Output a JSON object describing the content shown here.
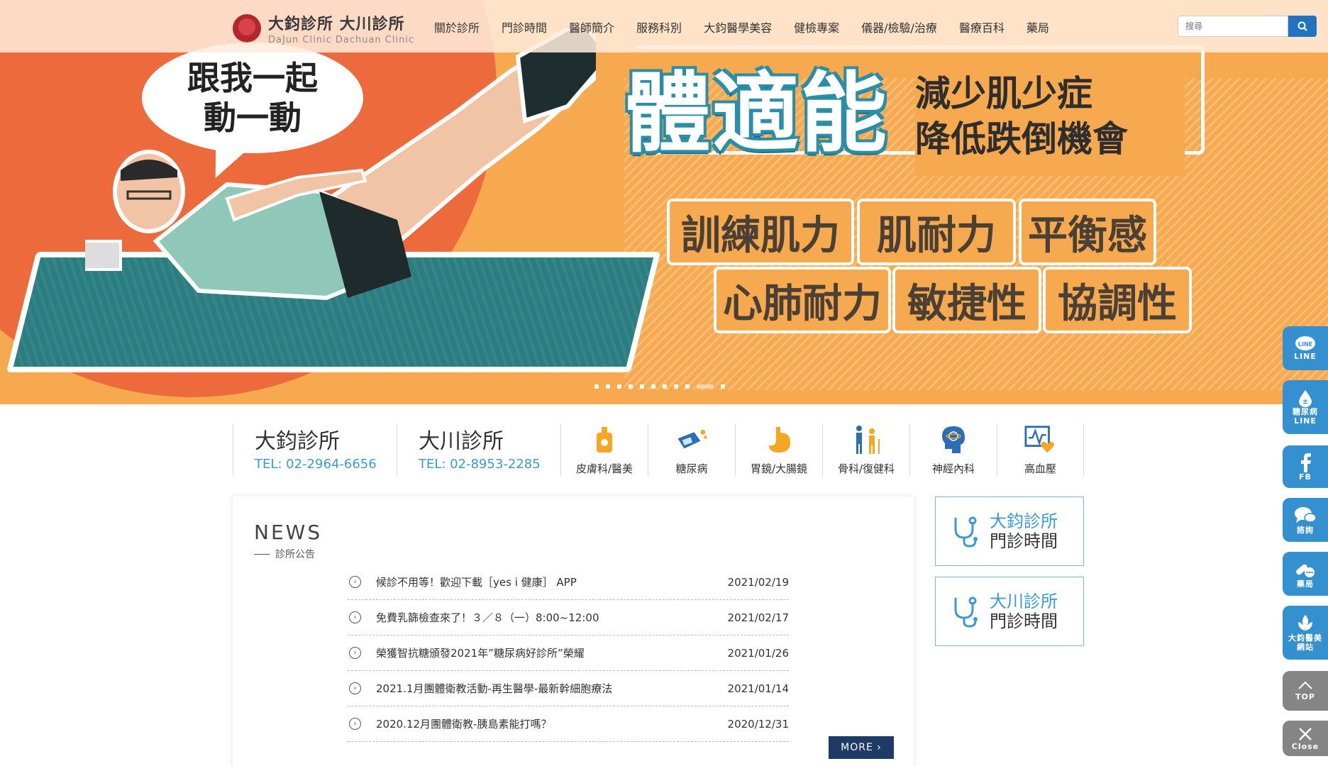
{
  "header": {
    "logo_zh": "大鈞診所 大川診所",
    "logo_en": "DaJun Clinic  Dachuan Clinic",
    "nav": [
      "關於診所",
      "門診時間",
      "醫師簡介",
      "服務科別",
      "大鈞醫學美容",
      "健檢專案",
      "儀器/檢驗/治療",
      "醫療百科",
      "藥局"
    ],
    "search_placeholder": "搜尋"
  },
  "hero": {
    "bubble": "跟我一起動一動",
    "title": "體適能",
    "sub1": "減少肌少症",
    "sub2": "降低跌倒機會",
    "skills": [
      "訓練肌力",
      "肌耐力",
      "平衡感",
      "心肺耐力",
      "敏捷性",
      "協調性"
    ],
    "slide_count": 11,
    "active_slide": 9
  },
  "contact": {
    "clinics": [
      {
        "name": "大鈞診所",
        "tel": "TEL: 02-2964-6656"
      },
      {
        "name": "大川診所",
        "tel": "TEL: 02-8953-2285"
      }
    ],
    "depts": [
      {
        "label": "皮膚科/醫美",
        "icon": "bottle-icon"
      },
      {
        "label": "糖尿病",
        "icon": "glucose-meter-icon"
      },
      {
        "label": "胃鏡/大腸鏡",
        "icon": "stomach-icon"
      },
      {
        "label": "骨科/復健科",
        "icon": "elderly-icon"
      },
      {
        "label": "神經內科",
        "icon": "brain-icon"
      },
      {
        "label": "高血壓",
        "icon": "heart-monitor-icon"
      }
    ]
  },
  "news": {
    "title_en": "NEWS",
    "title_zh": "診所公告",
    "items": [
      {
        "title": "候診不用等！歡迎下載［yes i 健康］ APP",
        "date": "2021/02/19"
      },
      {
        "title": "免費乳篩檢查來了！３／８（一）8:00~12:00",
        "date": "2021/02/17"
      },
      {
        "title": "榮獲智抗糖頒發2021年”糖尿病好診所”榮耀",
        "date": "2021/01/26"
      },
      {
        "title": "2021.1月團體衛教活動-再生醫學-最新幹細胞療法",
        "date": "2021/01/14"
      },
      {
        "title": "2020.12月團體衛教-胰島素能打嗎？",
        "date": "2020/12/31"
      }
    ],
    "more": "MORE"
  },
  "hours": [
    {
      "l1": "大鈞診所",
      "l2": "門診時間"
    },
    {
      "l1": "大川診所",
      "l2": "門診時間"
    }
  ],
  "side": [
    {
      "label": "LINE",
      "icon": "line-icon"
    },
    {
      "label": "糖尿病 LINE",
      "icon": "drop-icon"
    },
    {
      "label": "FB",
      "icon": "facebook-icon"
    },
    {
      "label": "諮詢",
      "icon": "chat-icon"
    },
    {
      "label": "藥局",
      "icon": "pill-icon"
    },
    {
      "label": "大鈞醫美網站",
      "icon": "lotus-icon"
    },
    {
      "label": "TOP",
      "icon": "chevron-up-icon"
    },
    {
      "label": "Close",
      "icon": "close-icon"
    }
  ],
  "colors": {
    "accent": "#3590cf",
    "hero_orange": "#f6a94e",
    "hero_red": "#ec6a3c",
    "navy": "#1e3a66"
  }
}
